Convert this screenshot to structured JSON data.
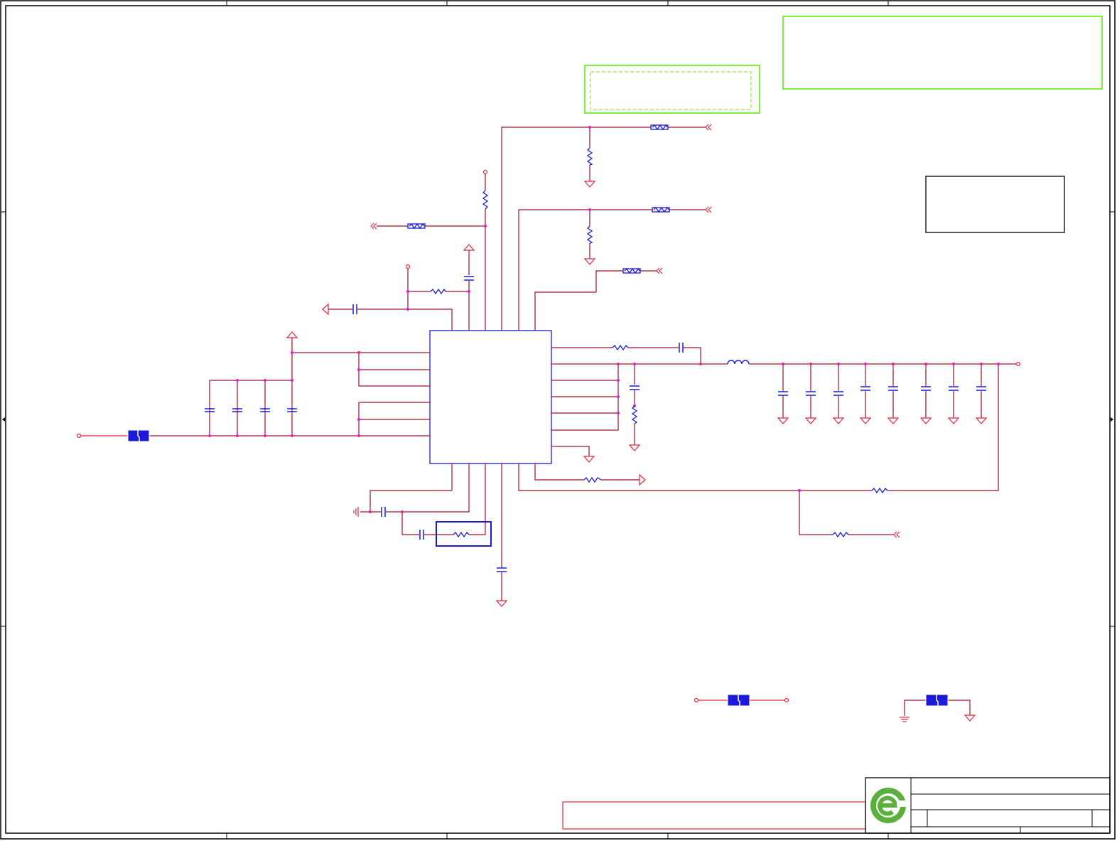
{
  "sheet": {
    "title_block": {
      "logo_icon": "company-logo-icon",
      "logo_color": "#5bb03c",
      "rows": [
        "",
        "",
        ""
      ]
    },
    "annotation_boxes": {
      "top_right_note": "",
      "middle_note": "",
      "right_note": "",
      "bottom_red_note": ""
    }
  },
  "colors": {
    "wire": "#a0122c",
    "component": "#1a1ad8",
    "junction": "#e020c8",
    "note_box": "#7cf03c",
    "border": "#000000"
  }
}
